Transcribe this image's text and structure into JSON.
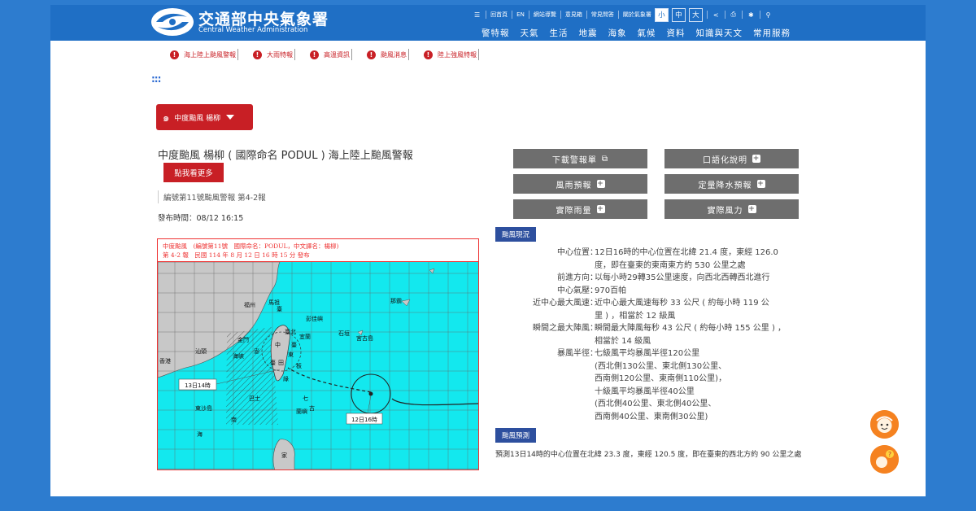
{
  "header": {
    "logo_zh": "交通部中央氣象署",
    "logo_en": "Central Weather Administration",
    "util_links": [
      "回首頁",
      "EN",
      "網站導覽",
      "意見箱",
      "常見問答",
      "關於氣象署"
    ],
    "font_sizes": [
      "小",
      "中",
      "大"
    ],
    "active_font_size": "小",
    "nav": [
      "警特報",
      "天氣",
      "生活",
      "地震",
      "海象",
      "氣候",
      "資料",
      "知識與天文",
      "常用服務"
    ],
    "colors": {
      "header": "#1f6fc5",
      "background": "#2d7ccf"
    }
  },
  "alerts": [
    {
      "label": "海上陸上颱風警報"
    },
    {
      "label": "大雨特報"
    },
    {
      "label": "高溫資訊"
    },
    {
      "label": "颱風消息"
    },
    {
      "label": "陸上強風特報"
    }
  ],
  "alert_color": "#c81f25",
  "selector": {
    "label": "中度颱風 楊柳",
    "icon": "typhoon-icon"
  },
  "warning": {
    "title": "中度颱風 楊柳 ( 國際命名 PODUL ) 海上陸上颱風警報",
    "more_button": "點我看更多",
    "report_no": "編號第11號颱風警報 第4-2報",
    "pubtime": "發布時間：08/12 16:15"
  },
  "map": {
    "header_line1": "中度颱風　(編號第11號　國際命名：PODUL，中文譯名：楊柳)",
    "header_line2": "第 4-2 報　民國 114 年 8 月 12 日 16 時 15 分 發布",
    "label_forecast": "13日14時",
    "label_current": "12日16時",
    "places": {
      "fuzhou": "福州",
      "mazu": "馬祖",
      "pengjia": "彭佳嶼",
      "taibei": "臺北",
      "yilan": "宜蘭",
      "jinmen": "金門",
      "shantou": "汕頭",
      "xianggang": "香港",
      "shiyuan": "石垣",
      "gonggu": "宮古島",
      "naba": "那霸",
      "dongsha": "東沙島",
      "lanyu": "蘭嶼",
      "haixia": "海峽",
      "bashi": "巴士",
      "nan": "南",
      "hai": "海",
      "pen": "澎",
      "tai": "臺",
      "zhong": "中",
      "dong": "東",
      "lu": "綠",
      "qi": "七",
      "gu": "古",
      "ban": "板",
      "jia": "家",
      "tw": "臺",
      "tai2": "臺",
      "tian": "田"
    }
  },
  "buttons": {
    "download": "下載警報單",
    "verbal": "口語化說明",
    "wind_rain": "風雨預報",
    "qpf": "定量降水預報",
    "rainfall": "實際雨量",
    "wind": "實際風力"
  },
  "situation": {
    "badge": "颱風現況",
    "rows": [
      {
        "key": "中心位置",
        "lines": [
          "12日16時的中心位置在北緯 21.4 度，東經 126.0",
          "度，即在臺東的東南東方約 530 公里之處"
        ]
      },
      {
        "key": "前進方向",
        "lines": [
          "以每小時29轉35公里速度，向西北西轉西北進行"
        ]
      },
      {
        "key": "中心氣壓",
        "lines": [
          "970百帕"
        ]
      },
      {
        "key": "近中心最大風速",
        "lines": [
          "近中心最大風速每秒 33 公尺 ( 約每小時 119 公",
          "里 ) ，相當於 12 級風"
        ]
      },
      {
        "key": "瞬間之最大陣風",
        "lines": [
          "瞬間最大陣風每秒 43 公尺 ( 約每小時 155 公里 ) ，",
          "相當於 14 級風"
        ]
      },
      {
        "key": "暴風半徑",
        "lines": [
          "七級風平均暴風半徑120公里",
          "(西北側130公里、東北側130公里、",
          "西南側120公里、東南側110公里)，",
          "十級風平均暴風半徑40公里",
          "(西北側40公里、東北側40公里、",
          "西南側40公里、東南側30公里)"
        ]
      }
    ]
  },
  "forecast": {
    "badge": "颱風預測",
    "text": "預測13日14時的中心位置在北緯 23.3 度，東經 120.5 度，即在臺東的西北方約 90 公里之處"
  }
}
